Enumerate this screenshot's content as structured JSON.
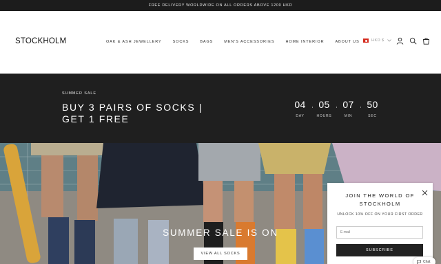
{
  "announcement": "FREE DELIVERY WORLDWIDE ON ALL ORDERS ABOVE 1200 HKD",
  "header": {
    "logo": "STOCKHOLM",
    "nav": [
      "OAK & ASH JEWELLERY",
      "SOCKS",
      "BAGS",
      "MEN'S ACCESSORIES",
      "HOME INTERIOR",
      "ABOUT US"
    ],
    "currency": "HKD $",
    "icons": [
      "account-icon",
      "search-icon",
      "cart-icon"
    ]
  },
  "promo": {
    "kicker": "SUMMER SALE",
    "title": "BUY 3 PAIRS OF SOCKS | GET 1 FREE",
    "countdown": [
      {
        "value": "04",
        "label": "DAY"
      },
      {
        "value": "05",
        "label": "HOURS"
      },
      {
        "value": "07",
        "label": "MIN"
      },
      {
        "value": "50",
        "label": "SEC"
      }
    ]
  },
  "hero": {
    "title": "SUMMER SALE IS ON",
    "button": "VIEW ALL SOCKS"
  },
  "popup": {
    "title": "JOIN THE WORLD OF STOCKHOLM",
    "subtitle": "UNLOCK 10% OFF ON YOUR FIRST ORDER",
    "email_placeholder": "E-mail",
    "button": "SUBSCRIBE"
  },
  "chat": {
    "label": "Chat"
  },
  "colors": {
    "dark_band": "#1f1f1f",
    "flag_red": "#d52b1e"
  }
}
